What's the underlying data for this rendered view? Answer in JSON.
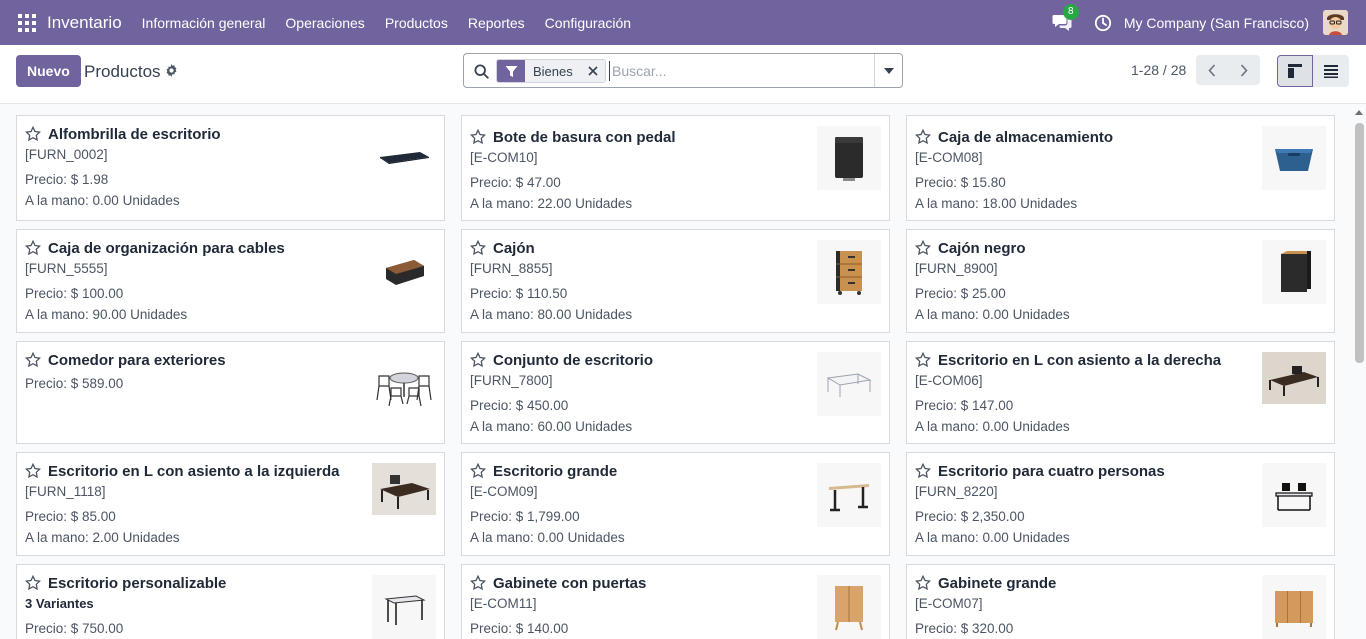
{
  "navbar": {
    "brand": "Inventario",
    "menu": [
      "Información general",
      "Operaciones",
      "Productos",
      "Reportes",
      "Configuración"
    ],
    "chat_badge": "8",
    "company": "My Company (San Francisco)",
    "accent": "#71639e"
  },
  "control_panel": {
    "new_label": "Nuevo",
    "title": "Productos",
    "facet_label": "Bienes",
    "search_placeholder": "Buscar...",
    "pager_text": "1-28 / 28"
  },
  "products": [
    {
      "name": "Alfombrilla de escritorio",
      "ref": "[FURN_0002]",
      "price": "Precio: $ 1.98",
      "onhand": "A la mano: 0.00 Unidades",
      "image": "desk-pad-image"
    },
    {
      "name": "Bote de basura con pedal",
      "ref": "[E-COM10]",
      "price": "Precio: $ 47.00",
      "onhand": "A la mano: 22.00 Unidades",
      "image": "pedal-bin-image"
    },
    {
      "name": "Caja de almacenamiento",
      "ref": "[E-COM08]",
      "price": "Precio: $ 15.80",
      "onhand": "A la mano: 18.00 Unidades",
      "image": "storage-box-image"
    },
    {
      "name": "Caja de organización para cables",
      "ref": "[FURN_5555]",
      "price": "Precio: $ 100.00",
      "onhand": "A la mano: 90.00 Unidades",
      "image": "cable-box-image"
    },
    {
      "name": "Cajón",
      "ref": "[FURN_8855]",
      "price": "Precio: $ 110.50",
      "onhand": "A la mano: 80.00 Unidades",
      "image": "drawer-image"
    },
    {
      "name": "Cajón negro",
      "ref": "[FURN_8900]",
      "price": "Precio: $ 25.00",
      "onhand": "A la mano: 0.00 Unidades",
      "image": "black-drawer-image"
    },
    {
      "name": "Comedor para exteriores",
      "ref": "",
      "price": "Precio: $ 589.00",
      "onhand": "",
      "image": "outdoor-dining-image"
    },
    {
      "name": "Conjunto de escritorio",
      "ref": "[FURN_7800]",
      "price": "Precio: $ 450.00",
      "onhand": "A la mano: 60.00 Unidades",
      "image": "desk-set-image"
    },
    {
      "name": "Escritorio en L con asiento a la derecha",
      "ref": "[E-COM06]",
      "price": "Precio: $ 147.00",
      "onhand": "A la mano: 0.00 Unidades",
      "image": "l-desk-right-image"
    },
    {
      "name": "Escritorio en L con asiento a la izquierda",
      "ref": "[FURN_1118]",
      "price": "Precio: $ 85.00",
      "onhand": "A la mano: 2.00 Unidades",
      "image": "l-desk-left-image"
    },
    {
      "name": "Escritorio grande",
      "ref": "[E-COM09]",
      "price": "Precio: $ 1,799.00",
      "onhand": "A la mano: 0.00 Unidades",
      "image": "large-desk-image"
    },
    {
      "name": "Escritorio para cuatro personas",
      "ref": "[FURN_8220]",
      "price": "Precio: $ 2,350.00",
      "onhand": "A la mano: 0.00 Unidades",
      "image": "four-person-desk-image"
    },
    {
      "name": "Escritorio personalizable",
      "variants": "3 Variantes",
      "price": "Precio: $ 750.00",
      "onhand": "",
      "image": "custom-desk-image"
    },
    {
      "name": "Gabinete con puertas",
      "ref": "[E-COM11]",
      "price": "Precio: $ 140.00",
      "onhand": "",
      "image": "cabinet-doors-image"
    },
    {
      "name": "Gabinete grande",
      "ref": "[E-COM07]",
      "price": "Precio: $ 320.00",
      "onhand": "",
      "image": "large-cabinet-image"
    }
  ]
}
